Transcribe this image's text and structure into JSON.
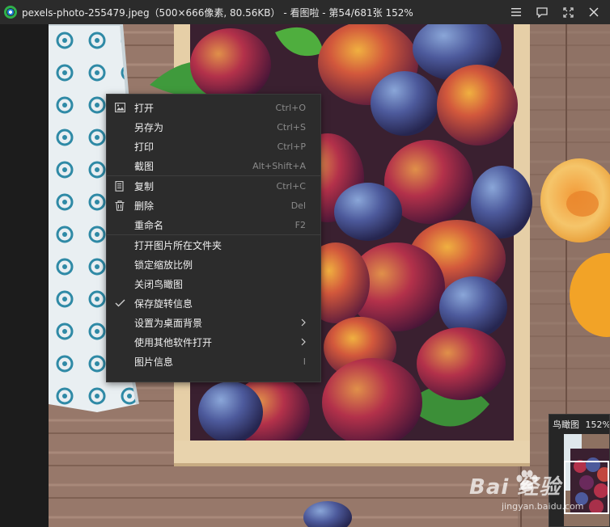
{
  "titlebar": {
    "title": "pexels-photo-255479.jpeg（500×666像素, 80.56KB） - 看图啦 - 第54/681张 152%",
    "controls": [
      "menu-icon",
      "feedback-icon",
      "fullscreen-icon",
      "close-icon"
    ]
  },
  "context_menu": {
    "items": [
      {
        "label": "打开",
        "shortcut": "Ctrl+O",
        "icon": "image-icon"
      },
      {
        "label": "另存为",
        "shortcut": "Ctrl+S"
      },
      {
        "label": "打印",
        "shortcut": "Ctrl+P"
      },
      {
        "label": "截图",
        "shortcut": "Alt+Shift+A"
      },
      {
        "label": "复制",
        "shortcut": "Ctrl+C",
        "icon": "copy-icon"
      },
      {
        "label": "删除",
        "shortcut": "Del",
        "icon": "trash-icon"
      },
      {
        "label": "重命名",
        "shortcut": "F2"
      },
      {
        "label": "打开图片所在文件夹"
      },
      {
        "label": "锁定缩放比例"
      },
      {
        "label": "关闭鸟瞰图"
      },
      {
        "label": "保存旋转信息",
        "checked": true
      },
      {
        "label": "设置为桌面背景",
        "submenu": true
      },
      {
        "label": "使用其他软件打开",
        "submenu": true
      },
      {
        "label": "图片信息",
        "shortcut": "I"
      }
    ]
  },
  "navigator": {
    "title": "鸟瞰图",
    "zoom": "152%"
  },
  "watermark": {
    "brand": "Bai  经验",
    "url": "jingyan.baidu.com"
  },
  "colors": {
    "titlebar_bg": "#2b2b2b",
    "menu_bg": "#2c2c2c",
    "menu_text": "#f0f0f0",
    "shortcut_text": "#8a8a8a"
  }
}
